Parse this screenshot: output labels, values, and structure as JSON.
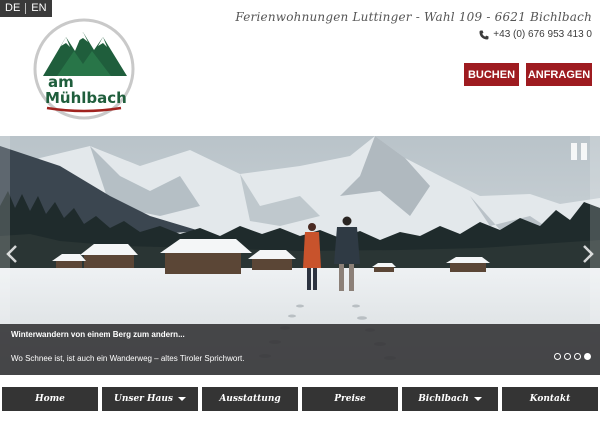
{
  "language": {
    "options": [
      "DE",
      "EN"
    ],
    "active": "DE"
  },
  "header": {
    "tagline": "Ferienwohnungen Luttinger - Wahl 109 - 6621 Bichlbach",
    "phone": "+43 (0) 676 953 413 0",
    "phone_icon": "phone-icon"
  },
  "logo": {
    "line1": "am",
    "line2": "Mühlbach",
    "colors": {
      "green": "#1f5e3c",
      "red": "#a0231f"
    }
  },
  "buttons": {
    "book": "BUCHEN",
    "ask": "ANFRAGEN"
  },
  "slider": {
    "caption_title": "Winterwandern von einem Berg zum andern...",
    "caption_text": "Wo Schnee ist, ist auch ein Wanderweg – altes Tiroler Sprichwort.",
    "slide_count": 4,
    "active_slide": 4,
    "icons": {
      "pause": "pause-icon",
      "prev": "chevron-left-icon",
      "next": "chevron-right-icon"
    }
  },
  "nav": {
    "items": [
      {
        "label": "Home",
        "dropdown": false
      },
      {
        "label": "Unser Haus",
        "dropdown": true
      },
      {
        "label": "Ausstattung",
        "dropdown": false
      },
      {
        "label": "Preise",
        "dropdown": false
      },
      {
        "label": "Bichlbach",
        "dropdown": true
      },
      {
        "label": "Kontakt",
        "dropdown": false
      }
    ]
  },
  "colors": {
    "accent": "#9e1b20",
    "nav_bg": "#343434",
    "caption_bg": "#303032"
  }
}
